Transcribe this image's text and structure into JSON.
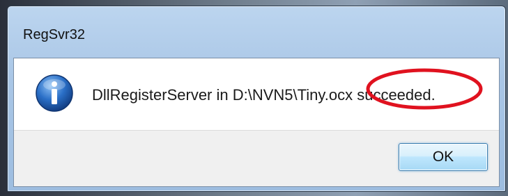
{
  "window": {
    "title": "RegSvr32"
  },
  "dialog": {
    "icon": "information-icon",
    "message": "DllRegisterServer in D:\\NVN5\\Tiny.ocx succeeded.",
    "ok_label": "OK"
  },
  "annotation": {
    "shape": "ellipse",
    "color": "#e0121f",
    "highlights": "succeeded."
  },
  "colors": {
    "titlebar": "#a9c6e6",
    "button_border": "#3c7fb1",
    "info_icon_blue": "#1f5fb0"
  }
}
